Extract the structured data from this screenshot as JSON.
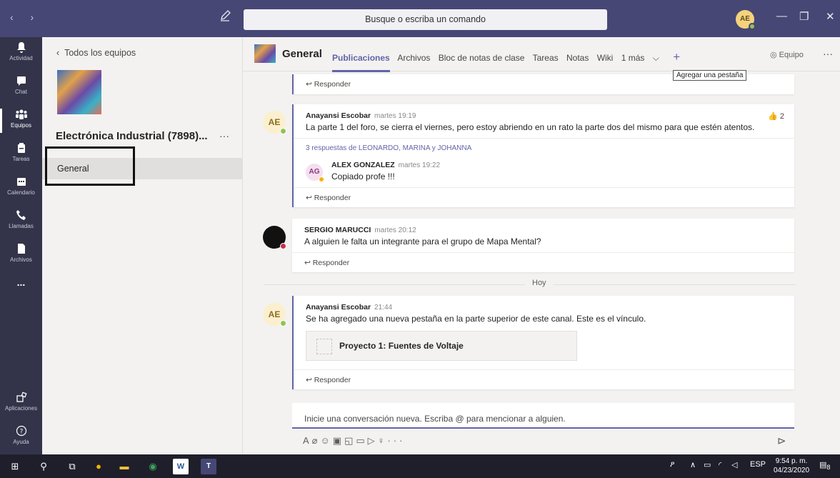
{
  "topbar": {
    "search_placeholder": "Busque o escriba un comando",
    "user_initials": "AE"
  },
  "rail": {
    "items": [
      {
        "label": "Actividad",
        "icon": "bell-icon"
      },
      {
        "label": "Chat",
        "icon": "chat-icon"
      },
      {
        "label": "Equipos",
        "icon": "teams-icon"
      },
      {
        "label": "Tareas",
        "icon": "assignments-icon"
      },
      {
        "label": "Calendario",
        "icon": "calendar-icon"
      },
      {
        "label": "Llamadas",
        "icon": "phone-icon"
      },
      {
        "label": "Archivos",
        "icon": "files-icon"
      }
    ],
    "more": "...",
    "apps_label": "Aplicaciones",
    "help_label": "Ayuda"
  },
  "teampanel": {
    "back_label": "Todos los equipos",
    "team_name": "Electrónica Industrial (7898)...",
    "more": "···",
    "channel": "General"
  },
  "channel": {
    "title": "General",
    "tabs": [
      "Publicaciones",
      "Archivos",
      "Bloc de notas de clase",
      "Tareas",
      "Notas",
      "Wiki",
      "1 más"
    ],
    "add_tab_tooltip": "Agregar una pestaña",
    "team_button": "Equipo"
  },
  "feed": {
    "reply_label": "Responder",
    "posts": [
      {
        "initials": "AE",
        "author": "Anayansi Escobar",
        "time": "martes 19:19",
        "text": "La parte 1 del foro, se cierra el viernes, pero estoy abriendo en un rato la parte dos del mismo para que estén atentos.",
        "likes": "2",
        "replies_link": "3 respuestas de LEONARDO, MARINA y JOHANNA",
        "nested": {
          "initials": "AG",
          "author": "ALEX GONZALEZ",
          "time": "martes 19:22",
          "text": "Copiado profe !!!"
        }
      },
      {
        "author": "SERGIO MARUCCI",
        "time": "martes 20:12",
        "text": "A alguien le falta un integrante para el grupo de Mapa Mental?"
      },
      {
        "initials": "AE",
        "author": "Anayansi Escobar",
        "time": "21:44",
        "text": "Se ha agregado una nueva pestaña en la parte superior de este canal. Este es el vínculo.",
        "link_card": "Proyecto 1: Fuentes de Voltaje"
      }
    ],
    "divider_label": "Hoy"
  },
  "compose": {
    "placeholder": "Inicie una conversación nueva. Escriba @ para mencionar a alguien."
  },
  "taskbar": {
    "lang": "ESP",
    "time": "9:54 p. m.",
    "date": "04/23/2020",
    "notifications": "8"
  }
}
